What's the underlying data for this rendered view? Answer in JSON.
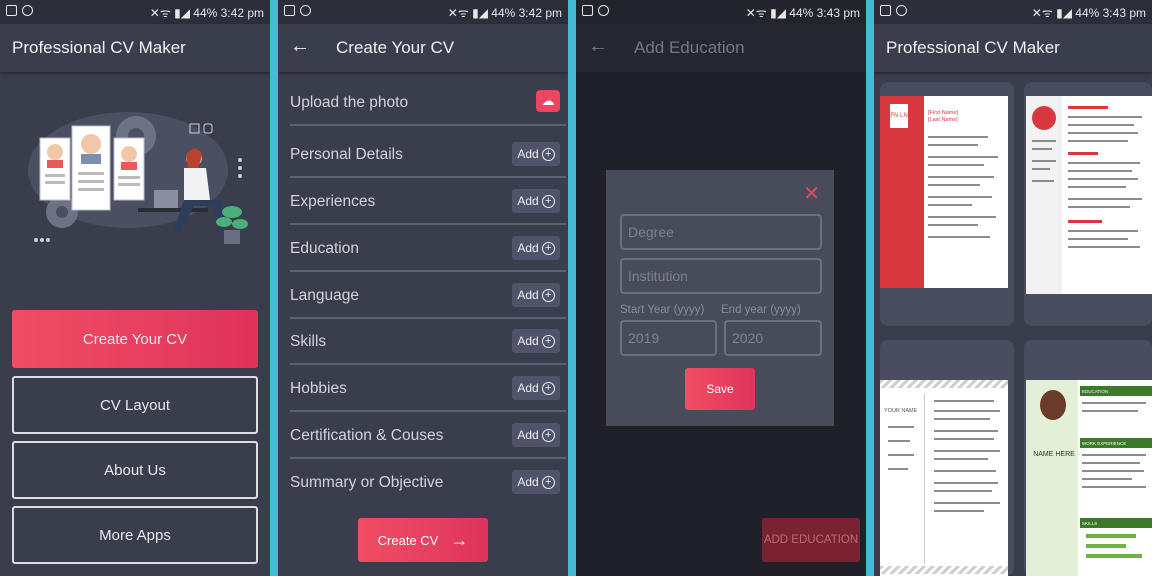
{
  "status": {
    "screen1": {
      "text": "44% 3:42 pm"
    },
    "screen2": {
      "text": "44% 3:42 pm"
    },
    "screen3": {
      "text": "44% 3:43 pm"
    },
    "screen4": {
      "text": "44% 3:43 pm"
    }
  },
  "screen1": {
    "title": "Professional CV Maker",
    "buttons": {
      "create": "Create Your CV",
      "layout": "CV Layout",
      "about": "About Us",
      "more": "More Apps"
    }
  },
  "screen2": {
    "title": "Create Your CV",
    "upload_label": "Upload the photo",
    "add_label": "Add",
    "sections": [
      {
        "label": "Personal Details"
      },
      {
        "label": "Experiences"
      },
      {
        "label": "Education"
      },
      {
        "label": "Language"
      },
      {
        "label": "Skills"
      },
      {
        "label": "Hobbies"
      },
      {
        "label": "Certification & Couses"
      },
      {
        "label": "Summary or Objective"
      }
    ],
    "create_button": "Create CV"
  },
  "screen3": {
    "title": "Add Education",
    "degree_placeholder": "Degree",
    "institution_placeholder": "Institution",
    "start_label": "Start Year (yyyy)",
    "end_label": "End year (yyyy)",
    "start_value": "2019",
    "end_value": "2020",
    "save": "Save",
    "add_education": "ADD EDUCATION"
  },
  "screen4": {
    "title": "Professional CV Maker",
    "template1": {
      "initials": "FN LN",
      "name_line1": "[First Name]",
      "name_line2": "[Last Name]"
    },
    "template3": {
      "name": "YOUR NAME"
    },
    "template4": {
      "name": "NAME HERE",
      "sections": [
        "EDUCATION",
        "WORK EXPERIENCE",
        "SKILLS"
      ]
    }
  },
  "colors": {
    "accent": "#ec4561",
    "background": "#3a3d4c",
    "stripe": "#45bcd1"
  }
}
